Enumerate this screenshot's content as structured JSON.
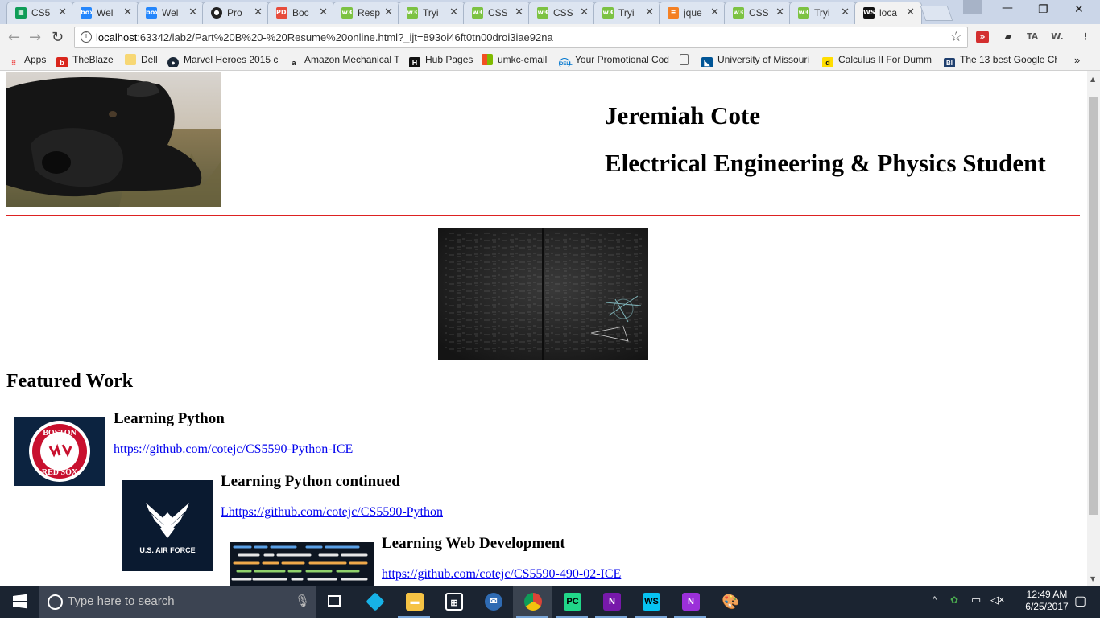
{
  "browser": {
    "tabs": [
      {
        "label": "CS5",
        "icon": "sheets-icon",
        "color": "#0f9d58"
      },
      {
        "label": "Wel",
        "icon": "box-icon",
        "color": "#2486fc"
      },
      {
        "label": "Wel",
        "icon": "box-icon",
        "color": "#2486fc"
      },
      {
        "label": "Pro",
        "icon": "github-icon",
        "color": "#222222"
      },
      {
        "label": "Boc",
        "icon": "pdf-icon",
        "color": "#e74c3c"
      },
      {
        "label": "Resp",
        "icon": "w3-icon",
        "color": "#7cc242"
      },
      {
        "label": "Tryi",
        "icon": "w3-icon",
        "color": "#7cc242"
      },
      {
        "label": "CSS",
        "icon": "w3-icon",
        "color": "#7cc242"
      },
      {
        "label": "CSS",
        "icon": "w3-icon",
        "color": "#7cc242"
      },
      {
        "label": "Tryi",
        "icon": "w3-icon",
        "color": "#7cc242"
      },
      {
        "label": "jque",
        "icon": "stackoverflow-icon",
        "color": "#f48024"
      },
      {
        "label": "CSS",
        "icon": "w3-icon",
        "color": "#7cc242"
      },
      {
        "label": "Tryi",
        "icon": "w3-icon",
        "color": "#7cc242"
      },
      {
        "label": "loca",
        "icon": "webstorm-icon",
        "color": "#111111"
      }
    ],
    "active_tab_index": 13,
    "url_host": "localhost",
    "url_rest": ":63342/lab2/Part%20B%20-%20Resume%20online.html?_ijt=893oi46ft0tn00droi3iae92na",
    "bookmarks": [
      {
        "label": "Apps",
        "icon": "apps-grid-icon",
        "color": "#e44"
      },
      {
        "label": "TheBlaze",
        "icon": "theblaze-icon",
        "color": "#d9261c"
      },
      {
        "label": "Dell",
        "icon": "folder-icon",
        "color": "#f7d774"
      },
      {
        "label": "Marvel Heroes 2015 c",
        "icon": "steam-icon",
        "color": "#1b2838"
      },
      {
        "label": "Amazon Mechanical T",
        "icon": "amazon-icon",
        "color": "#ffffff"
      },
      {
        "label": "Hub Pages",
        "icon": "hubpages-icon",
        "color": "#111111"
      },
      {
        "label": "umkc-email",
        "icon": "microsoft-icon",
        "color": "#f25022"
      },
      {
        "label": "Your Promotional Cod",
        "icon": "dell-icon",
        "color": "#0076ce"
      },
      {
        "label": "",
        "icon": "page-icon",
        "color": "#ffffff"
      },
      {
        "label": "University of Missouri",
        "icon": "umkc-icon",
        "color": "#005596"
      },
      {
        "label": "Calculus II For Dumm",
        "icon": "dummies-icon",
        "color": "#ffdd00"
      },
      {
        "label": "The 13 best Google Ch",
        "icon": "businessinsider-icon",
        "color": "#1f3f6e"
      }
    ]
  },
  "page": {
    "name": "Jeremiah Cote",
    "tagline": "Electrical Engineering & Physics Student",
    "featured_heading": "Featured Work",
    "rule_color": "#dd2222",
    "works": [
      {
        "title": "Learning Python",
        "link": "https://github.com/cotejc/CS5590-Python-ICE",
        "image": "red-sox-logo"
      },
      {
        "title": "Learning Python continued",
        "link": "Lhttps://github.com/cotejc/CS5590-Python",
        "image": "air-force-logo"
      },
      {
        "title": "Learning Web Development",
        "link": "https://github.com/cotejc/CS5590-490-02-ICE",
        "image": "code-screen-photo"
      }
    ],
    "logo_text": {
      "sox_top": "BOSTON",
      "sox_bottom": "RED SOX",
      "air_force": "U.S. AIR FORCE"
    }
  },
  "taskbar": {
    "search_placeholder": "Type here to search",
    "time": "12:49 AM",
    "date": "6/25/2017",
    "apps": [
      "task-view-icon",
      "kodi-icon",
      "file-explorer-icon",
      "store-icon",
      "thunderbird-icon",
      "chrome-icon",
      "pycharm-icon",
      "onenote-icon",
      "webstorm-icon",
      "onenote-icon",
      "paint-icon"
    ]
  }
}
